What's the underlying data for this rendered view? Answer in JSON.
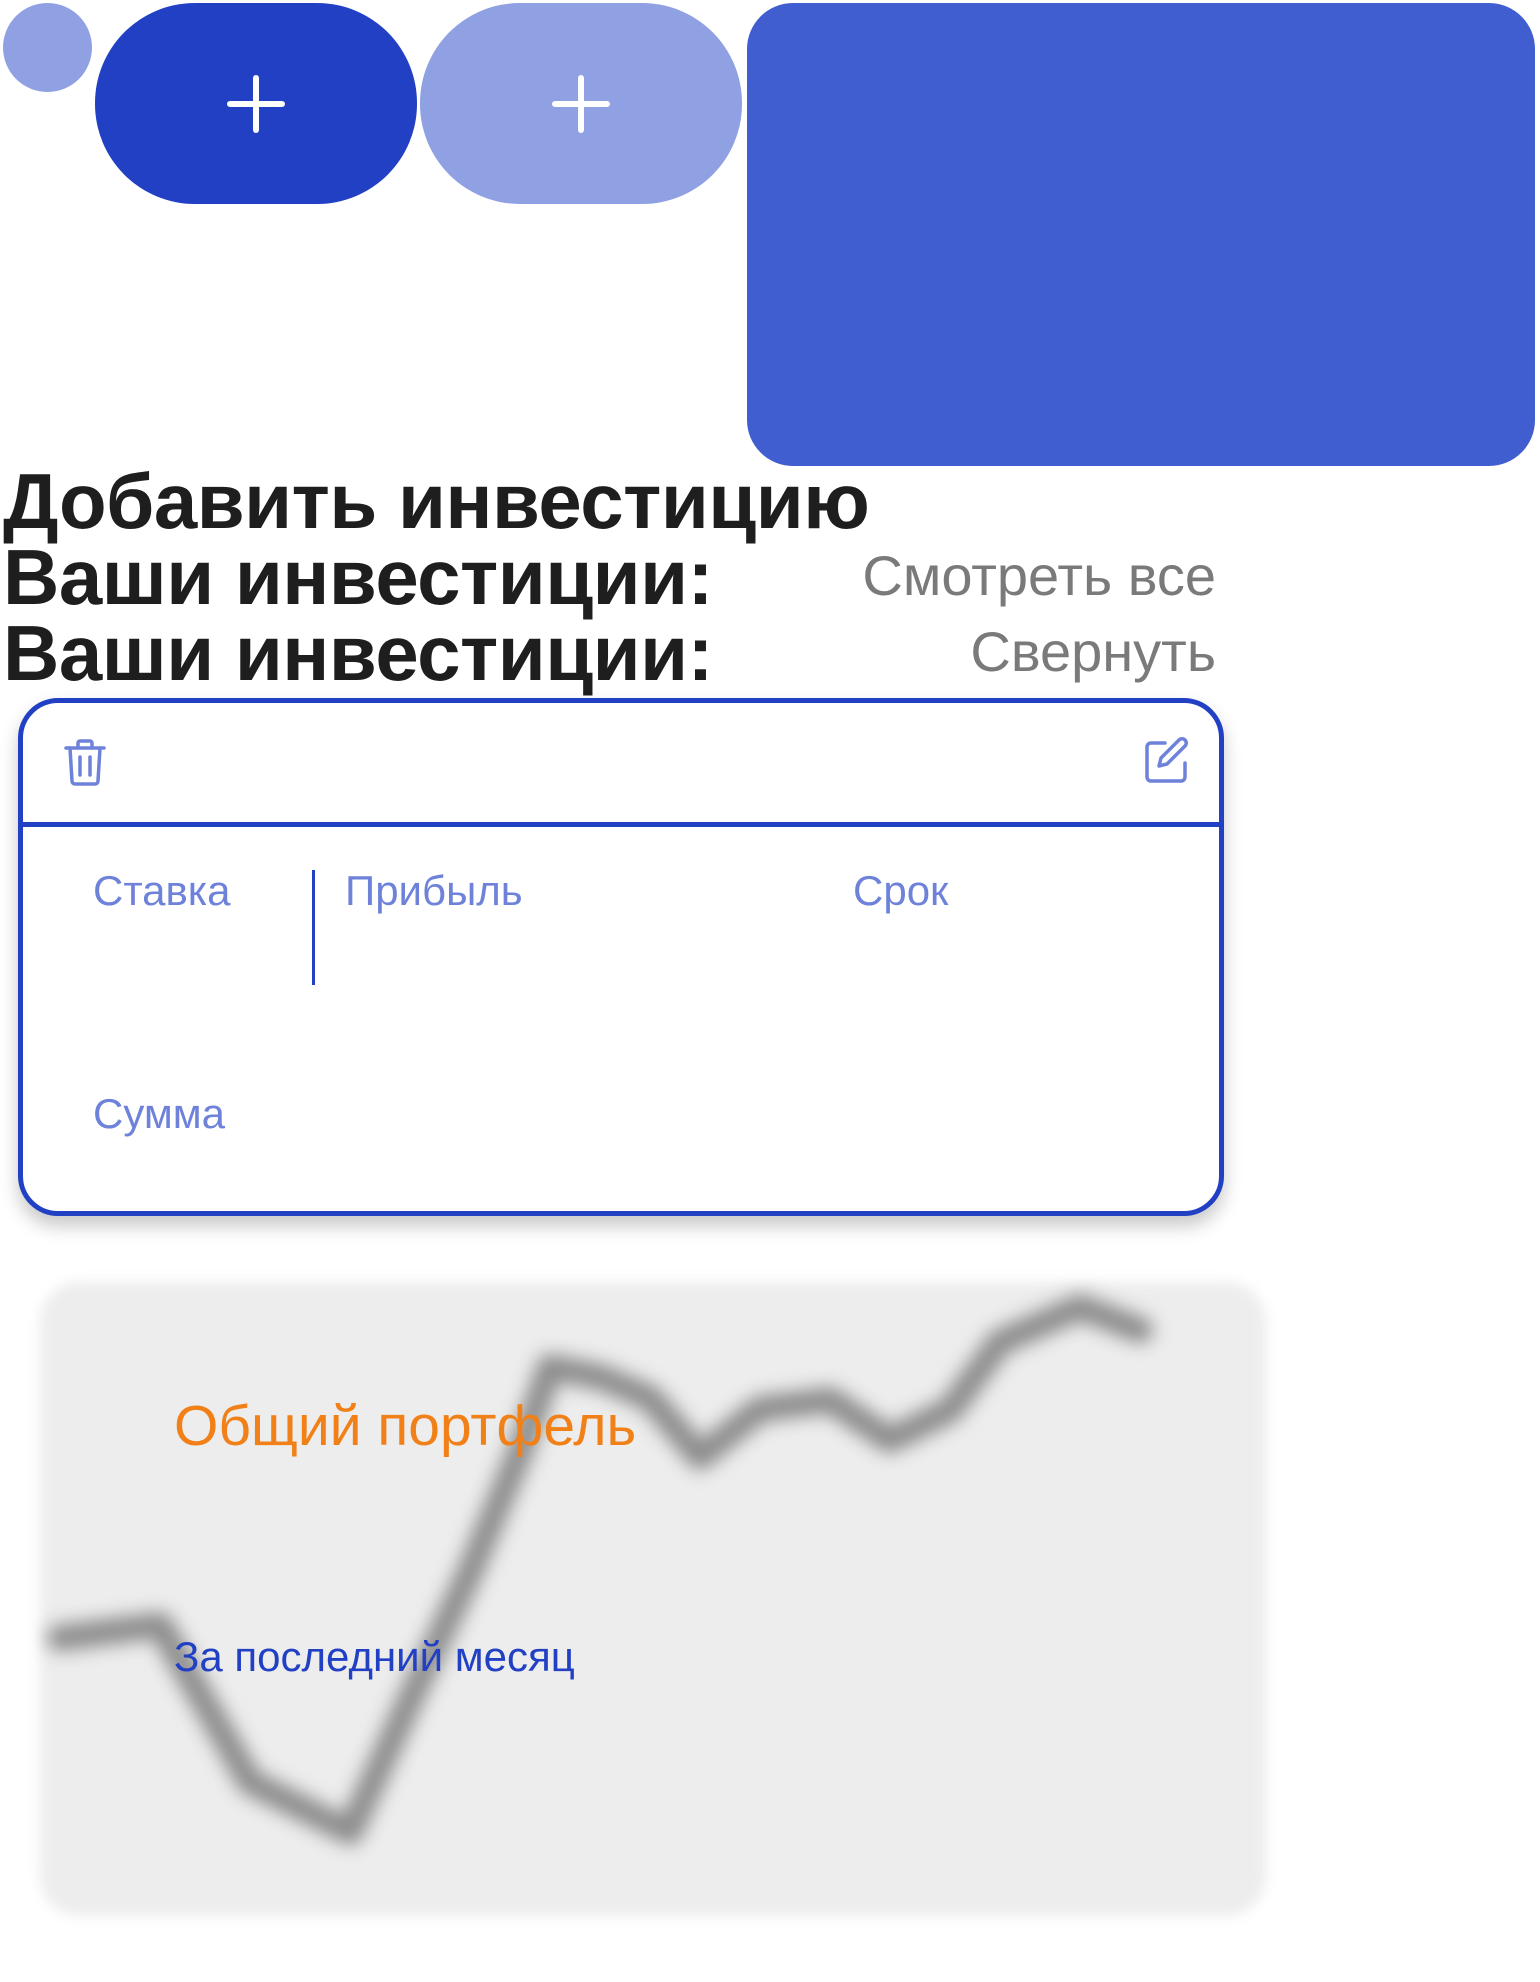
{
  "top_tiles": {
    "primary_add_icon": "plus-icon",
    "secondary_add_icon": "plus-icon"
  },
  "headings": {
    "add_investment": "Добавить инвестицию",
    "your_investments": "Ваши инвестиции:",
    "your_investments_repeat": "Ваши инвестиции:"
  },
  "links": {
    "view_all": "Смотреть все",
    "collapse": "Свернуть"
  },
  "investment_card": {
    "delete_icon": "trash-icon",
    "edit_icon": "edit-icon",
    "rate_label": "Ставка",
    "profit_label": "Прибыль",
    "term_label": "Срок",
    "sum_label": "Сумма"
  },
  "portfolio": {
    "title": "Общий портфель",
    "subtitle": "За последний месяц"
  },
  "colors": {
    "primary_blue": "#2140c4",
    "light_blue": "#8fa0e3",
    "card_blue": "#405ecf",
    "label_blue": "#6e82da",
    "orange": "#f08017",
    "muted_gray": "#7a7a7a"
  }
}
